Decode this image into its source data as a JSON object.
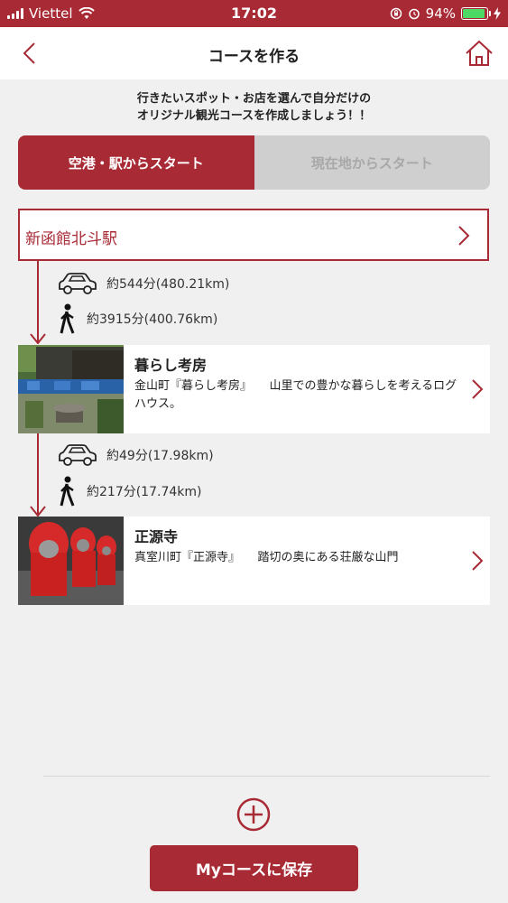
{
  "status_bar": {
    "carrier": "Viettel",
    "time": "17:02",
    "battery": "94%",
    "battery_level": 0.94
  },
  "nav": {
    "title": "コースを作る",
    "back_icon": "chevron-left-icon",
    "home_icon": "home-icon"
  },
  "intro": {
    "line1": "行きたいスポット・お店を選んで自分だけの",
    "line2": "オリジナル観光コースを作成しましょう！！"
  },
  "start_tabs": [
    {
      "label": "空港・駅からスタート",
      "active": true
    },
    {
      "label": "現在地からスタート",
      "active": false
    }
  ],
  "start_point": {
    "label": "新函館北斗駅"
  },
  "legs": [
    {
      "car": "約544分(480.21km)",
      "walk": "約3915分(400.76km)"
    },
    {
      "car": "約49分(17.98km)",
      "walk": "約217分(17.74km)"
    }
  ],
  "spots": [
    {
      "title": "暮らし考房",
      "desc": "金山町『暮らし考房』　　山里での豊かな暮らしを考えるログハウス。"
    },
    {
      "title": "正源寺",
      "desc": "真室川町『正源寺』　　踏切の奥にある荘厳な山門"
    }
  ],
  "actions": {
    "save_label": "Myコースに保存"
  },
  "colors": {
    "accent": "#a82a35",
    "background": "#f0f0f0"
  }
}
